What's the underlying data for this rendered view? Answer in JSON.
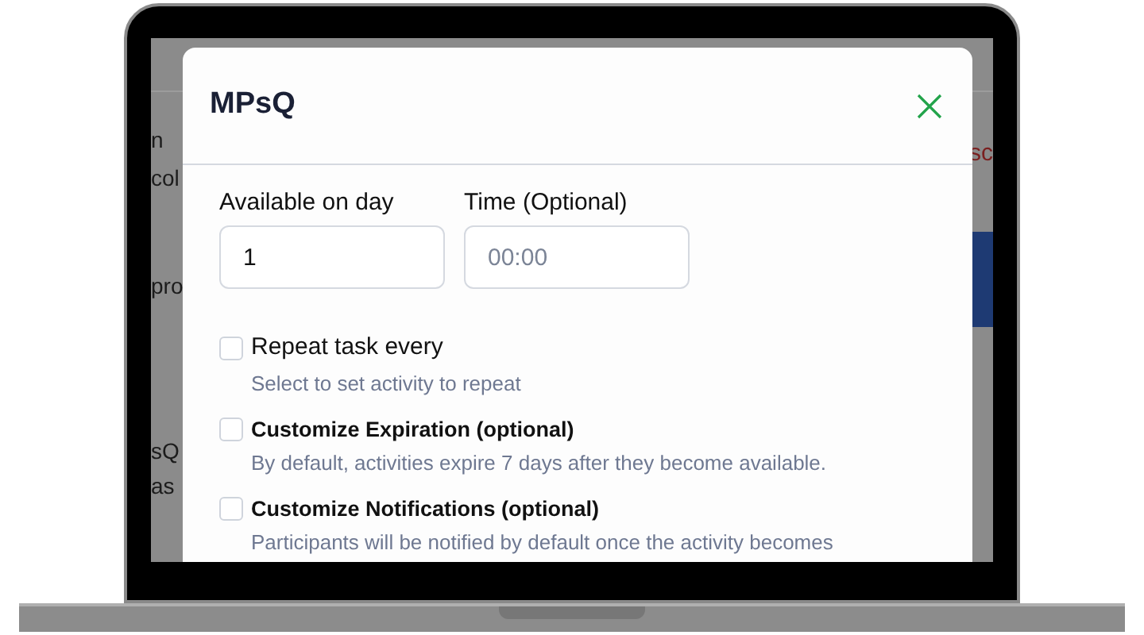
{
  "background_page": {
    "side_text": "sc",
    "fragments": [
      {
        "text": "n"
      },
      {
        "text": "col"
      },
      {
        "text": "pro"
      },
      {
        "text": "sQ"
      },
      {
        "text": "as"
      }
    ]
  },
  "dialog": {
    "title": "MPsQ",
    "fields": [
      {
        "label": "Available on day",
        "value": "1"
      },
      {
        "label": "Time (Optional)",
        "placeholder": "00:00"
      }
    ],
    "options": [
      {
        "label": "Repeat task every",
        "emphasized": false,
        "checked": false,
        "description": "Select to set activity to repeat"
      },
      {
        "label": "Customize Expiration (optional)",
        "emphasized": true,
        "checked": false,
        "description": "By default, activities expire 7 days after they become available."
      },
      {
        "label": "Customize Notifications (optional)",
        "emphasized": true,
        "checked": false,
        "description": "Participants will be notified by default once the activity becomes"
      }
    ]
  }
}
